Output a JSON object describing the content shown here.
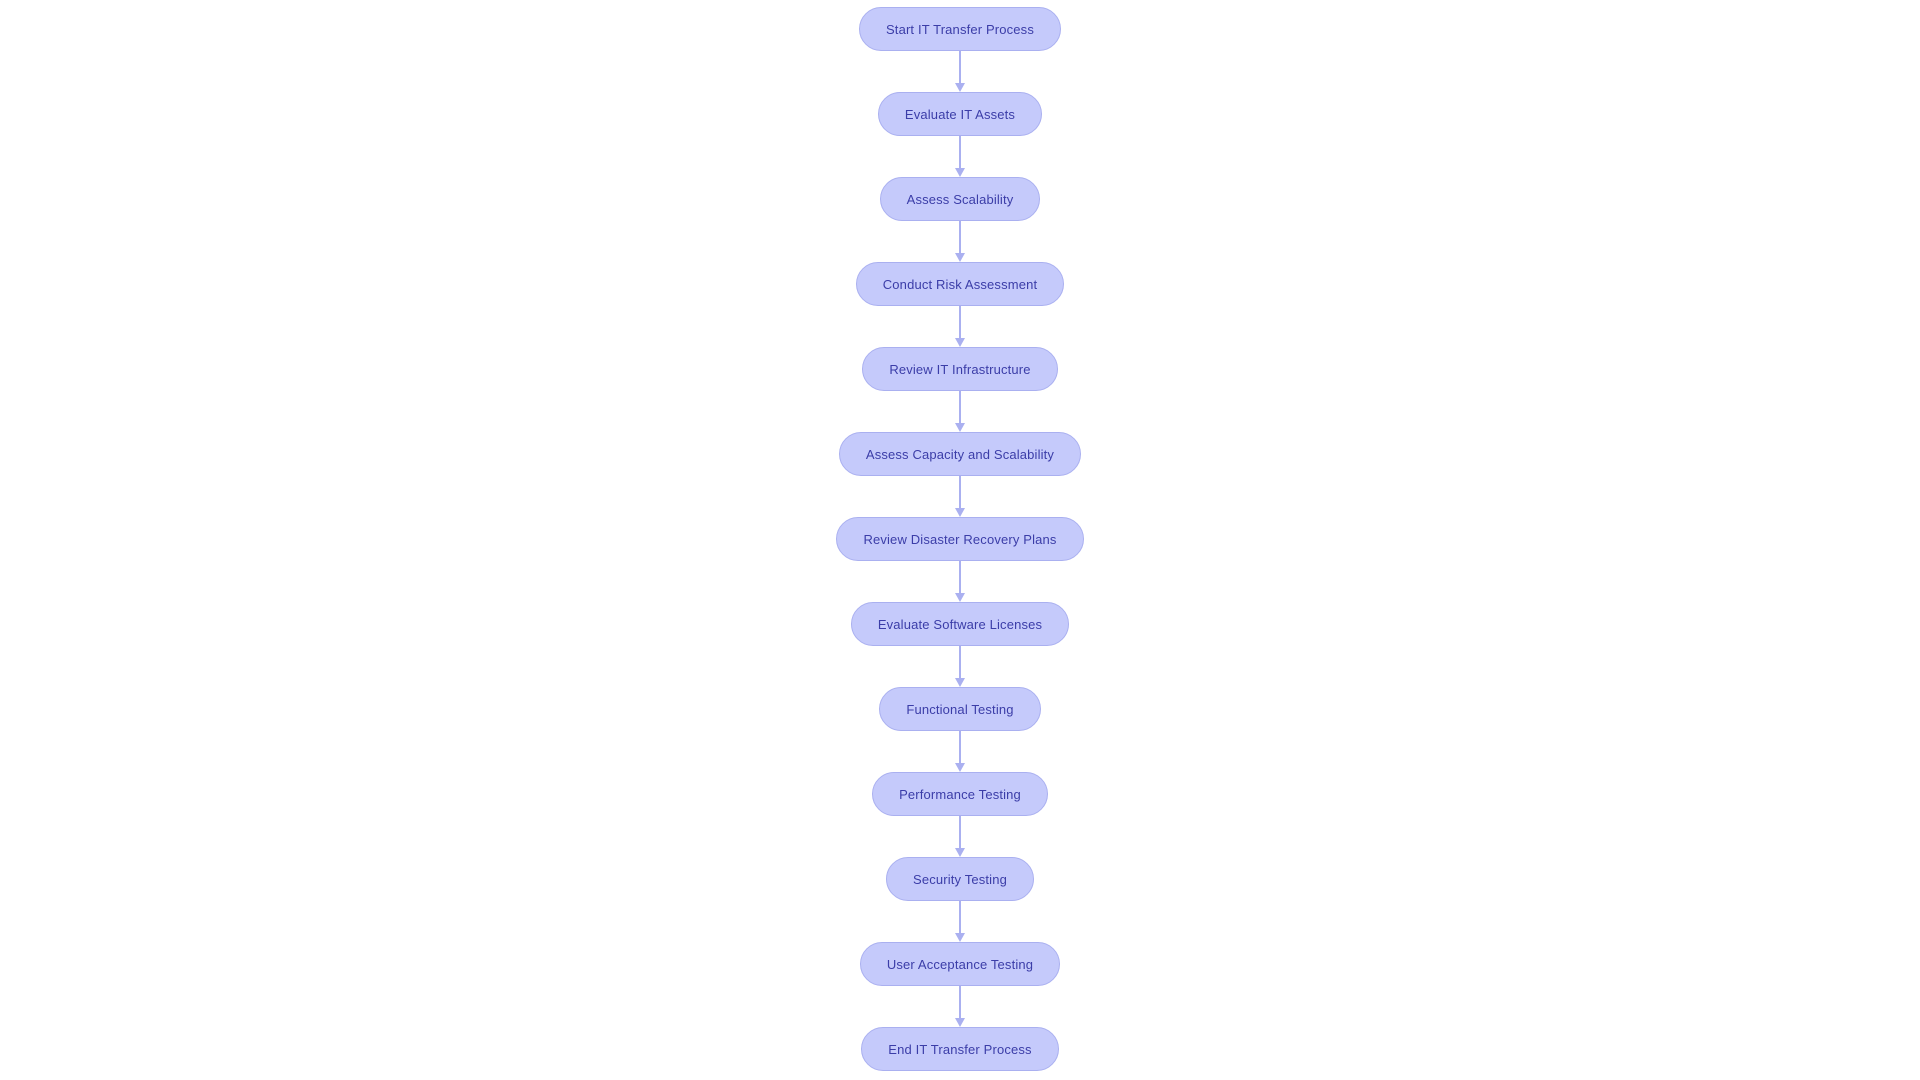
{
  "diagram": {
    "title": "IT Transfer Process Flowchart",
    "type": "flowchart",
    "orientation": "top-to-bottom",
    "background_color": "#ffffff",
    "node_fill_color": "#c5cafb",
    "node_border_color": "#aab0f0",
    "node_text_color": "#3b3da8",
    "edge_color": "#aab0f0",
    "node_shape": "stadium",
    "edge_style": "solid-arrow",
    "node_count": 14,
    "edge_count": 13,
    "nodes": [
      {
        "id": "n1",
        "label": "Start IT Transfer Process"
      },
      {
        "id": "n2",
        "label": "Evaluate IT Assets"
      },
      {
        "id": "n3",
        "label": "Assess Scalability"
      },
      {
        "id": "n4",
        "label": "Conduct Risk Assessment"
      },
      {
        "id": "n5",
        "label": "Review IT Infrastructure"
      },
      {
        "id": "n6",
        "label": "Assess Capacity and Scalability"
      },
      {
        "id": "n7",
        "label": "Review Disaster Recovery Plans"
      },
      {
        "id": "n8",
        "label": "Evaluate Software Licenses"
      },
      {
        "id": "n9",
        "label": "Functional Testing"
      },
      {
        "id": "n10",
        "label": "Performance Testing"
      },
      {
        "id": "n11",
        "label": "Security Testing"
      },
      {
        "id": "n12",
        "label": "User Acceptance Testing"
      },
      {
        "id": "n13",
        "label": "End IT Transfer Process"
      }
    ],
    "edges": [
      {
        "from": "n1",
        "to": "n2",
        "label": ""
      },
      {
        "from": "n2",
        "to": "n3",
        "label": ""
      },
      {
        "from": "n3",
        "to": "n4",
        "label": ""
      },
      {
        "from": "n4",
        "to": "n5",
        "label": ""
      },
      {
        "from": "n5",
        "to": "n6",
        "label": ""
      },
      {
        "from": "n6",
        "to": "n7",
        "label": ""
      },
      {
        "from": "n7",
        "to": "n8",
        "label": ""
      },
      {
        "from": "n8",
        "to": "n9",
        "label": ""
      },
      {
        "from": "n9",
        "to": "n10",
        "label": ""
      },
      {
        "from": "n10",
        "to": "n11",
        "label": ""
      },
      {
        "from": "n11",
        "to": "n12",
        "label": ""
      },
      {
        "from": "n12",
        "to": "n13",
        "label": ""
      }
    ]
  }
}
